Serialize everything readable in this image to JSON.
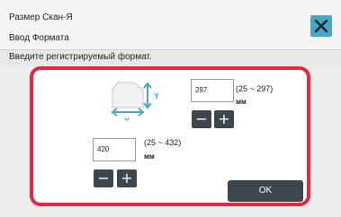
{
  "header": {
    "title": "Размер Скан-Я",
    "subtitle": "Ввод Формата",
    "close_icon": "close-icon",
    "accent_color": "#4aa7c4"
  },
  "instruction": "Введите регистрируемый формат.",
  "panel": {
    "highlight_color": "#e4293e",
    "paper_icon": "paper-size-icon",
    "y_axis_label": "Y",
    "x_axis_label": "X"
  },
  "y_field": {
    "value": "297",
    "range": "(25 ~ 297)",
    "unit": "мм",
    "minus_label": "−",
    "plus_label": "+"
  },
  "x_field": {
    "value": "420",
    "range": "(25 ~ 432)",
    "unit": "мм",
    "minus_label": "−",
    "plus_label": "+"
  },
  "ok_label": "OK"
}
